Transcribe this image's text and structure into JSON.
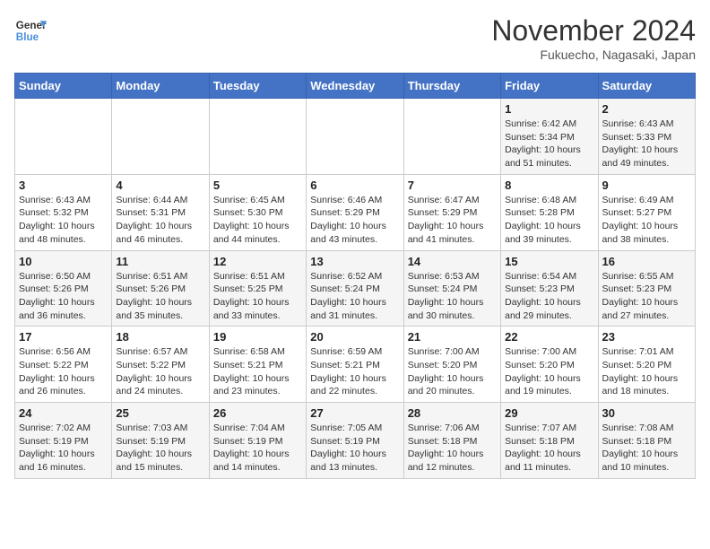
{
  "header": {
    "logo_line1": "General",
    "logo_line2": "Blue",
    "month_year": "November 2024",
    "location": "Fukuecho, Nagasaki, Japan"
  },
  "days_of_week": [
    "Sunday",
    "Monday",
    "Tuesday",
    "Wednesday",
    "Thursday",
    "Friday",
    "Saturday"
  ],
  "weeks": [
    [
      null,
      null,
      null,
      null,
      null,
      {
        "day": "1",
        "sunrise": "6:42 AM",
        "sunset": "5:34 PM",
        "daylight": "10 hours and 51 minutes."
      },
      {
        "day": "2",
        "sunrise": "6:43 AM",
        "sunset": "5:33 PM",
        "daylight": "10 hours and 49 minutes."
      }
    ],
    [
      {
        "day": "3",
        "sunrise": "6:43 AM",
        "sunset": "5:32 PM",
        "daylight": "10 hours and 48 minutes."
      },
      {
        "day": "4",
        "sunrise": "6:44 AM",
        "sunset": "5:31 PM",
        "daylight": "10 hours and 46 minutes."
      },
      {
        "day": "5",
        "sunrise": "6:45 AM",
        "sunset": "5:30 PM",
        "daylight": "10 hours and 44 minutes."
      },
      {
        "day": "6",
        "sunrise": "6:46 AM",
        "sunset": "5:29 PM",
        "daylight": "10 hours and 43 minutes."
      },
      {
        "day": "7",
        "sunrise": "6:47 AM",
        "sunset": "5:29 PM",
        "daylight": "10 hours and 41 minutes."
      },
      {
        "day": "8",
        "sunrise": "6:48 AM",
        "sunset": "5:28 PM",
        "daylight": "10 hours and 39 minutes."
      },
      {
        "day": "9",
        "sunrise": "6:49 AM",
        "sunset": "5:27 PM",
        "daylight": "10 hours and 38 minutes."
      }
    ],
    [
      {
        "day": "10",
        "sunrise": "6:50 AM",
        "sunset": "5:26 PM",
        "daylight": "10 hours and 36 minutes."
      },
      {
        "day": "11",
        "sunrise": "6:51 AM",
        "sunset": "5:26 PM",
        "daylight": "10 hours and 35 minutes."
      },
      {
        "day": "12",
        "sunrise": "6:51 AM",
        "sunset": "5:25 PM",
        "daylight": "10 hours and 33 minutes."
      },
      {
        "day": "13",
        "sunrise": "6:52 AM",
        "sunset": "5:24 PM",
        "daylight": "10 hours and 31 minutes."
      },
      {
        "day": "14",
        "sunrise": "6:53 AM",
        "sunset": "5:24 PM",
        "daylight": "10 hours and 30 minutes."
      },
      {
        "day": "15",
        "sunrise": "6:54 AM",
        "sunset": "5:23 PM",
        "daylight": "10 hours and 29 minutes."
      },
      {
        "day": "16",
        "sunrise": "6:55 AM",
        "sunset": "5:23 PM",
        "daylight": "10 hours and 27 minutes."
      }
    ],
    [
      {
        "day": "17",
        "sunrise": "6:56 AM",
        "sunset": "5:22 PM",
        "daylight": "10 hours and 26 minutes."
      },
      {
        "day": "18",
        "sunrise": "6:57 AM",
        "sunset": "5:22 PM",
        "daylight": "10 hours and 24 minutes."
      },
      {
        "day": "19",
        "sunrise": "6:58 AM",
        "sunset": "5:21 PM",
        "daylight": "10 hours and 23 minutes."
      },
      {
        "day": "20",
        "sunrise": "6:59 AM",
        "sunset": "5:21 PM",
        "daylight": "10 hours and 22 minutes."
      },
      {
        "day": "21",
        "sunrise": "7:00 AM",
        "sunset": "5:20 PM",
        "daylight": "10 hours and 20 minutes."
      },
      {
        "day": "22",
        "sunrise": "7:00 AM",
        "sunset": "5:20 PM",
        "daylight": "10 hours and 19 minutes."
      },
      {
        "day": "23",
        "sunrise": "7:01 AM",
        "sunset": "5:20 PM",
        "daylight": "10 hours and 18 minutes."
      }
    ],
    [
      {
        "day": "24",
        "sunrise": "7:02 AM",
        "sunset": "5:19 PM",
        "daylight": "10 hours and 16 minutes."
      },
      {
        "day": "25",
        "sunrise": "7:03 AM",
        "sunset": "5:19 PM",
        "daylight": "10 hours and 15 minutes."
      },
      {
        "day": "26",
        "sunrise": "7:04 AM",
        "sunset": "5:19 PM",
        "daylight": "10 hours and 14 minutes."
      },
      {
        "day": "27",
        "sunrise": "7:05 AM",
        "sunset": "5:19 PM",
        "daylight": "10 hours and 13 minutes."
      },
      {
        "day": "28",
        "sunrise": "7:06 AM",
        "sunset": "5:18 PM",
        "daylight": "10 hours and 12 minutes."
      },
      {
        "day": "29",
        "sunrise": "7:07 AM",
        "sunset": "5:18 PM",
        "daylight": "10 hours and 11 minutes."
      },
      {
        "day": "30",
        "sunrise": "7:08 AM",
        "sunset": "5:18 PM",
        "daylight": "10 hours and 10 minutes."
      }
    ]
  ]
}
